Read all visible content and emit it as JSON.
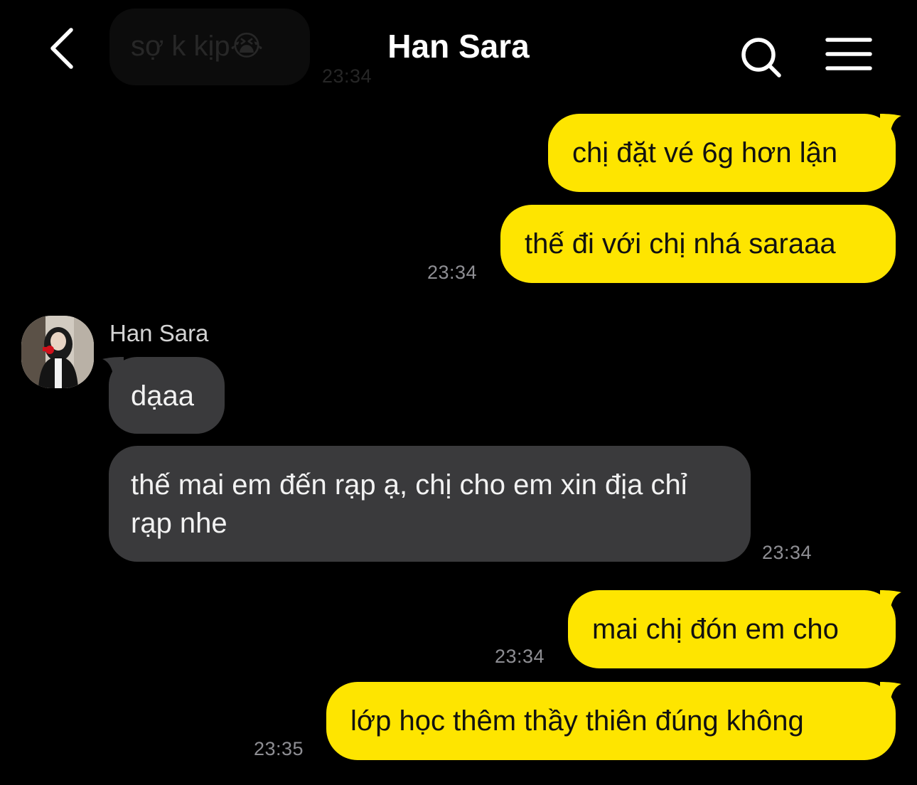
{
  "ghost": {
    "text": "sợ k kịp😭",
    "time": "23:34"
  },
  "header": {
    "title": "Han Sara"
  },
  "sender": {
    "name": "Han Sara"
  },
  "messages": [
    {
      "side": "out",
      "text": "chị đặt vé 6g hơn lận"
    },
    {
      "side": "out",
      "text": "thế đi với chị nhá saraaa",
      "time": "23:34"
    },
    {
      "side": "in",
      "text": "dạaa"
    },
    {
      "side": "in",
      "text": "thế mai em đến rạp ạ, chị cho em xin địa chỉ rạp nhe",
      "time": "23:34"
    },
    {
      "side": "out",
      "text": "mai chị đón em cho",
      "time": "23:34"
    },
    {
      "side": "out",
      "text": "lớp học thêm thầy thiên đúng không",
      "time": "23:35"
    }
  ],
  "colors": {
    "background": "#000000",
    "outgoing_bubble": "#fee500",
    "incoming_bubble": "#3a3a3c",
    "timestamp": "#8e8e93"
  },
  "icons": {
    "back": "chevron-left-icon",
    "search": "search-icon",
    "menu": "hamburger-menu-icon"
  }
}
